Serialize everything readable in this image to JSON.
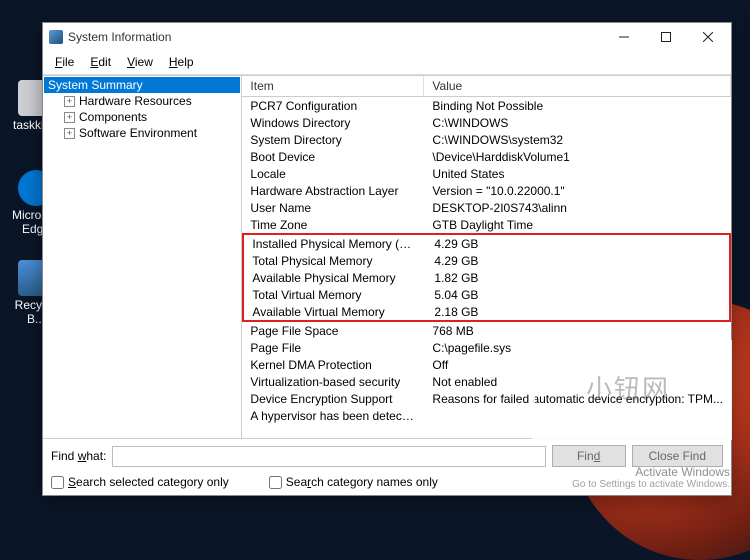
{
  "desktop": {
    "taskkill": "taskkill...",
    "edge": "Microsoft Edge",
    "recycle": "Recycle B..."
  },
  "window": {
    "title": "System Information",
    "menus": [
      "File",
      "Edit",
      "View",
      "Help"
    ]
  },
  "tree": {
    "root": "System Summary",
    "children": [
      "Hardware Resources",
      "Components",
      "Software Environment"
    ]
  },
  "grid": {
    "header_item": "Item",
    "header_value": "Value",
    "rows_top": [
      {
        "item": "PCR7 Configuration",
        "value": "Binding Not Possible"
      },
      {
        "item": "Windows Directory",
        "value": "C:\\WINDOWS"
      },
      {
        "item": "System Directory",
        "value": "C:\\WINDOWS\\system32"
      },
      {
        "item": "Boot Device",
        "value": "\\Device\\HarddiskVolume1"
      },
      {
        "item": "Locale",
        "value": "United States"
      },
      {
        "item": "Hardware Abstraction Layer",
        "value": "Version = \"10.0.22000.1\""
      },
      {
        "item": "User Name",
        "value": "DESKTOP-2I0S743\\alinn"
      },
      {
        "item": "Time Zone",
        "value": "GTB Daylight Time"
      }
    ],
    "rows_highlight": [
      {
        "item": "Installed Physical Memory (RAM)",
        "value": "4.29 GB"
      },
      {
        "item": "Total Physical Memory",
        "value": "4.29 GB"
      },
      {
        "item": "Available Physical Memory",
        "value": "1.82 GB"
      },
      {
        "item": "Total Virtual Memory",
        "value": "5.04 GB"
      },
      {
        "item": "Available Virtual Memory",
        "value": "2.18 GB"
      }
    ],
    "rows_bottom": [
      {
        "item": "Page File Space",
        "value": "768 MB"
      },
      {
        "item": "Page File",
        "value": "C:\\pagefile.sys"
      },
      {
        "item": "Kernel DMA Protection",
        "value": "Off"
      },
      {
        "item": "Virtualization-based security",
        "value": "Not enabled"
      },
      {
        "item": "Device Encryption Support",
        "value": "Reasons for failed automatic device encryption: TPM..."
      },
      {
        "item": "A hypervisor has been detected...",
        "value": ""
      }
    ]
  },
  "search": {
    "label": "Find what:",
    "find_btn": "Find",
    "close_btn": "Close Find",
    "selected_only": "Search selected category only",
    "names_only": "Search category names only"
  },
  "activate": {
    "title": "Activate Windows",
    "sub": "Go to Settings to activate Windows."
  },
  "cn_watermark": "小钮网"
}
